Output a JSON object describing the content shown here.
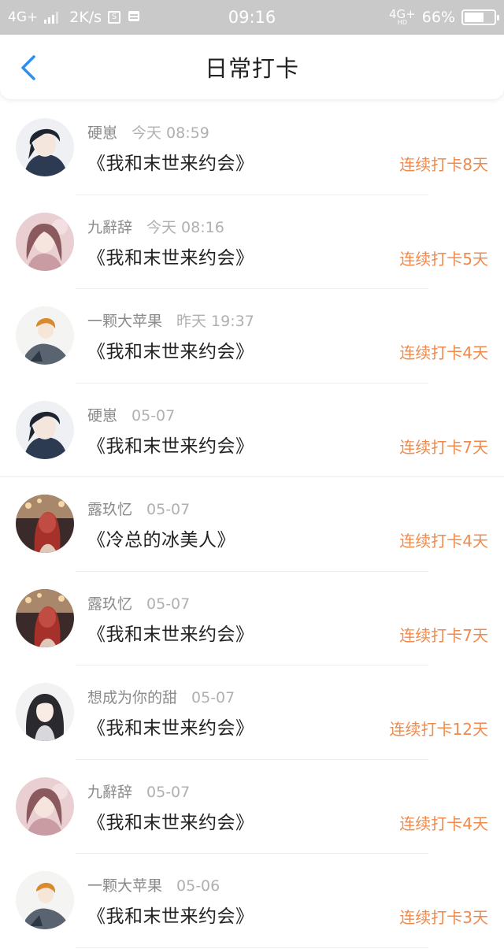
{
  "status_bar": {
    "network": "4G+",
    "speed": "2K/s",
    "time": "09:16",
    "network_right": "4G+",
    "network_right_sub": "HD",
    "battery_level": "66%",
    "battery_fraction": 0.66
  },
  "header": {
    "back_icon": "chevron-left-icon",
    "back_color": "#2f8ff0",
    "title": "日常打卡"
  },
  "colors": {
    "streak": "#ef8a4c",
    "meta": "#8a8a8a",
    "time": "#b0b0b0"
  },
  "items": [
    {
      "user": "硬崽",
      "time": "今天 08:59",
      "book": "《我和末世来约会》",
      "streak": "连续打卡8天",
      "avatar": "anime-boy-dark-hair"
    },
    {
      "user": "九辭辞",
      "time": "今天 08:16",
      "book": "《我和末世来约会》",
      "streak": "连续打卡5天",
      "avatar": "anime-girl-pink"
    },
    {
      "user": "一颗大苹果",
      "time": "昨天 19:37",
      "book": "《我和末世来约会》",
      "streak": "连续打卡4天",
      "avatar": "anime-boy-orange-hair"
    },
    {
      "user": "硬崽",
      "time": "05-07",
      "book": "《我和末世来约会》",
      "streak": "连续打卡7天",
      "avatar": "anime-boy-dark-hair"
    },
    {
      "user": "露玖忆",
      "time": "05-07",
      "book": "《冷总的冰美人》",
      "streak": "连续打卡4天",
      "avatar": "anime-girl-red"
    },
    {
      "user": "露玖忆",
      "time": "05-07",
      "book": "《我和末世来约会》",
      "streak": "连续打卡7天",
      "avatar": "anime-girl-red"
    },
    {
      "user": "想成为你的甜",
      "time": "05-07",
      "book": "《我和末世来约会》",
      "streak": "连续打卡12天",
      "avatar": "anime-girl-black-hair"
    },
    {
      "user": "九辭辞",
      "time": "05-07",
      "book": "《我和末世来约会》",
      "streak": "连续打卡4天",
      "avatar": "anime-girl-pink"
    },
    {
      "user": "一颗大苹果",
      "time": "05-06",
      "book": "《我和末世来约会》",
      "streak": "连续打卡3天",
      "avatar": "anime-boy-orange-hair"
    }
  ]
}
